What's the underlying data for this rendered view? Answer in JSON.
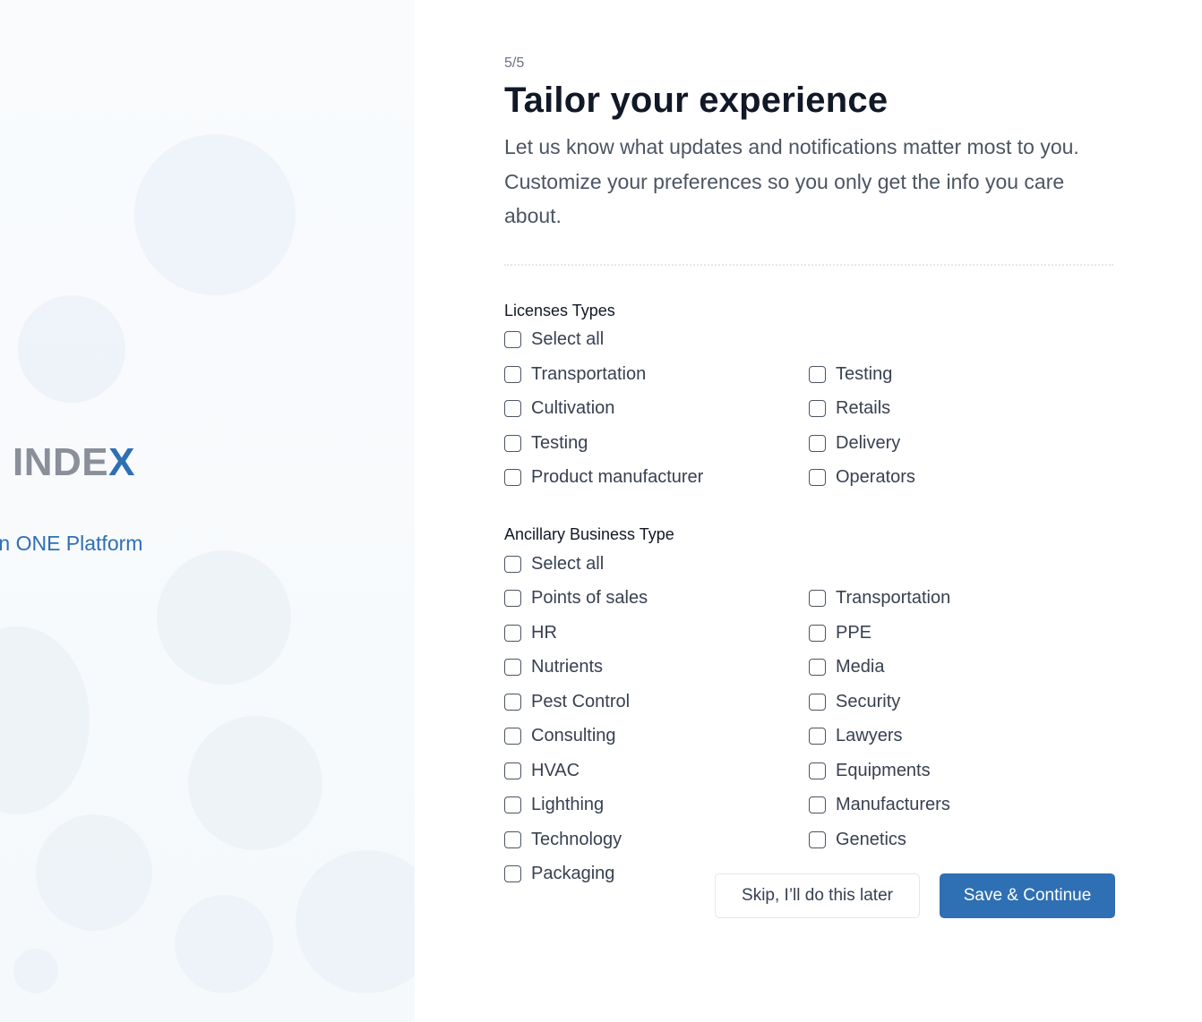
{
  "brand": {
    "logo_text_main": "INDE",
    "logo_text_accent": "X",
    "tagline": "In ONE Platform",
    "accent_color": "#2f6fb4"
  },
  "header": {
    "step": "5/5",
    "title": "Tailor your experience",
    "subtitle": "Let us know what updates and notifications matter most to you. Customize your preferences so you only get the info you care about."
  },
  "licenses": {
    "title": "Licenses Types",
    "select_all": "Select all",
    "options": [
      "Transportation",
      "Testing",
      "Cultivation",
      "Retails",
      "Testing",
      "Delivery",
      "Product manufacturer",
      "Operators"
    ]
  },
  "ancillary": {
    "title": "Ancillary Business Type",
    "select_all": "Select all",
    "options": [
      "Points of sales",
      "Transportation",
      "HR",
      "PPE",
      "Nutrients",
      "Media",
      "Pest Control",
      "Security",
      "Consulting",
      "Lawyers",
      "HVAC",
      "Equipments",
      "Lighthing",
      "Manufacturers",
      "Technology",
      "Genetics",
      "Packaging"
    ]
  },
  "actions": {
    "skip_label": "Skip, I’ll do this later",
    "save_label": "Save & Continue"
  }
}
